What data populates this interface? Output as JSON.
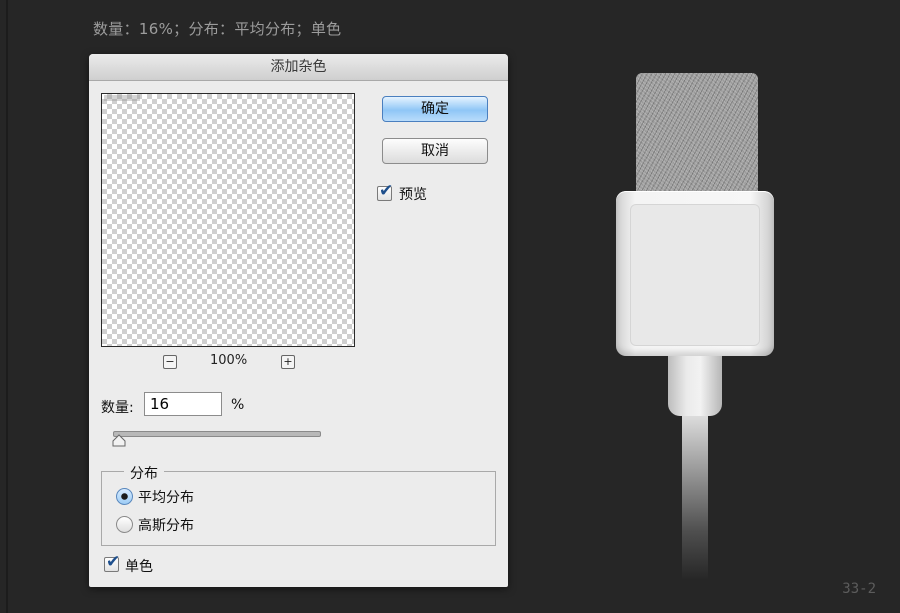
{
  "caption": "数量：16%；分布：平均分布；单色",
  "page_number": "33-2",
  "dialog": {
    "title": "添加杂色",
    "zoom_level": "100%",
    "zoom_out_symbol": "−",
    "zoom_in_symbol": "+",
    "ok_label": "确定",
    "cancel_label": "取消",
    "preview_label": "预览",
    "preview_checked": true,
    "amount_label": "数量:",
    "amount_value": "16",
    "amount_unit": "%",
    "amount_slider_fraction": 0.16,
    "distribution": {
      "legend": "分布",
      "options": [
        {
          "label": "平均分布",
          "selected": true
        },
        {
          "label": "高斯分布",
          "selected": false
        }
      ]
    },
    "monochromatic_label": "单色",
    "monochromatic_checked": true
  },
  "colors": {
    "background": "#262626",
    "dialog_bg": "#ececec",
    "default_button": "#8fc6f6",
    "noise_swatch": "#9a9a9a"
  }
}
